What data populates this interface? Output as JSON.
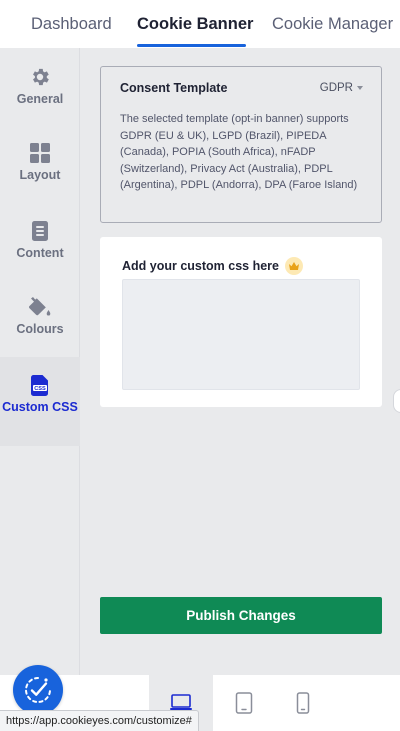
{
  "tabs": [
    {
      "label": "Dashboard",
      "active": false
    },
    {
      "label": "Cookie Banner",
      "active": true
    },
    {
      "label": "Cookie Manager",
      "active": false
    }
  ],
  "sidebar": {
    "items": [
      {
        "label": "General",
        "icon": "gear-icon"
      },
      {
        "label": "Layout",
        "icon": "grid-icon"
      },
      {
        "label": "Content",
        "icon": "document-icon"
      },
      {
        "label": "Colours",
        "icon": "paint-bucket-icon"
      },
      {
        "label": "Custom CSS",
        "icon": "css-file-icon",
        "active": true
      }
    ]
  },
  "template_card": {
    "title": "Consent Template",
    "selected": "GDPR",
    "description": "The selected template (opt-in banner) supports GDPR (EU & UK), LGPD (Brazil), PIPEDA (Canada), POPIA (South Africa), nFADP (Switzerland), Privacy Act (Australia), PDPL (Argentina), PDPL (Andorra), DPA (Faroe Island)"
  },
  "css_card": {
    "title": "Add your custom css here",
    "value": ""
  },
  "publish_label": "Publish Changes",
  "devices": [
    "desktop",
    "tablet",
    "mobile"
  ],
  "status_url": "https://app.cookieyes.com/customize#",
  "colors": {
    "accent": "#1863dc",
    "active_sidebar": "#1c2bd1",
    "publish": "#0f8a55"
  }
}
